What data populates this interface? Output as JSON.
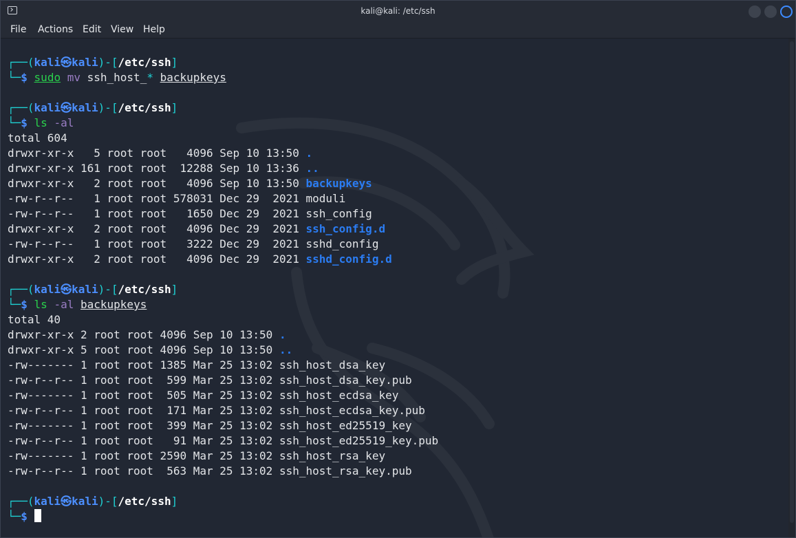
{
  "window": {
    "title": "kali@kali: /etc/ssh",
    "menu": [
      "File",
      "Actions",
      "Edit",
      "View",
      "Help"
    ]
  },
  "prompt": {
    "user": "kali",
    "host": "kali",
    "at": "㉿",
    "cwd": "/etc/ssh",
    "symbol": "$"
  },
  "blocks": [
    {
      "command": "sudo",
      "args": [
        {
          "text": "mv",
          "style": "arg"
        },
        {
          "text": "ssh_host_",
          "style": "plain"
        },
        {
          "text": "*",
          "style": "teal"
        },
        {
          "text": "backupkeys",
          "style": "u"
        }
      ]
    },
    {
      "command": "ls",
      "args": [
        {
          "text": "-al",
          "style": "arg"
        }
      ],
      "output": [
        {
          "text": "total 604"
        },
        {
          "text": "drwxr-xr-x   5 root root   4096 Sep 10 13:50 ",
          "name": ".",
          "dir": true
        },
        {
          "text": "drwxr-xr-x 161 root root  12288 Sep 10 13:36 ",
          "name": "..",
          "dir": true
        },
        {
          "text": "drwxr-xr-x   2 root root   4096 Sep 10 13:50 ",
          "name": "backupkeys",
          "dir": true
        },
        {
          "text": "-rw-r--r--   1 root root 578031 Dec 29  2021 ",
          "name": "moduli"
        },
        {
          "text": "-rw-r--r--   1 root root   1650 Dec 29  2021 ",
          "name": "ssh_config"
        },
        {
          "text": "drwxr-xr-x   2 root root   4096 Dec 29  2021 ",
          "name": "ssh_config.d",
          "dir": true
        },
        {
          "text": "-rw-r--r--   1 root root   3222 Dec 29  2021 ",
          "name": "sshd_config"
        },
        {
          "text": "drwxr-xr-x   2 root root   4096 Dec 29  2021 ",
          "name": "sshd_config.d",
          "dir": true
        }
      ]
    },
    {
      "command": "ls",
      "args": [
        {
          "text": "-al",
          "style": "arg"
        },
        {
          "text": "backupkeys",
          "style": "u"
        }
      ],
      "output": [
        {
          "text": "total 40"
        },
        {
          "text": "drwxr-xr-x 2 root root 4096 Sep 10 13:50 ",
          "name": ".",
          "dir": true
        },
        {
          "text": "drwxr-xr-x 5 root root 4096 Sep 10 13:50 ",
          "name": "..",
          "dir": true
        },
        {
          "text": "-rw------- 1 root root 1385 Mar 25 13:02 ",
          "name": "ssh_host_dsa_key"
        },
        {
          "text": "-rw-r--r-- 1 root root  599 Mar 25 13:02 ",
          "name": "ssh_host_dsa_key.pub"
        },
        {
          "text": "-rw------- 1 root root  505 Mar 25 13:02 ",
          "name": "ssh_host_ecdsa_key"
        },
        {
          "text": "-rw-r--r-- 1 root root  171 Mar 25 13:02 ",
          "name": "ssh_host_ecdsa_key.pub"
        },
        {
          "text": "-rw------- 1 root root  399 Mar 25 13:02 ",
          "name": "ssh_host_ed25519_key"
        },
        {
          "text": "-rw-r--r-- 1 root root   91 Mar 25 13:02 ",
          "name": "ssh_host_ed25519_key.pub"
        },
        {
          "text": "-rw------- 1 root root 2590 Mar 25 13:02 ",
          "name": "ssh_host_rsa_key"
        },
        {
          "text": "-rw-r--r-- 1 root root  563 Mar 25 13:02 ",
          "name": "ssh_host_rsa_key.pub"
        }
      ]
    },
    {
      "command": "",
      "args": [],
      "cursor": true
    }
  ]
}
